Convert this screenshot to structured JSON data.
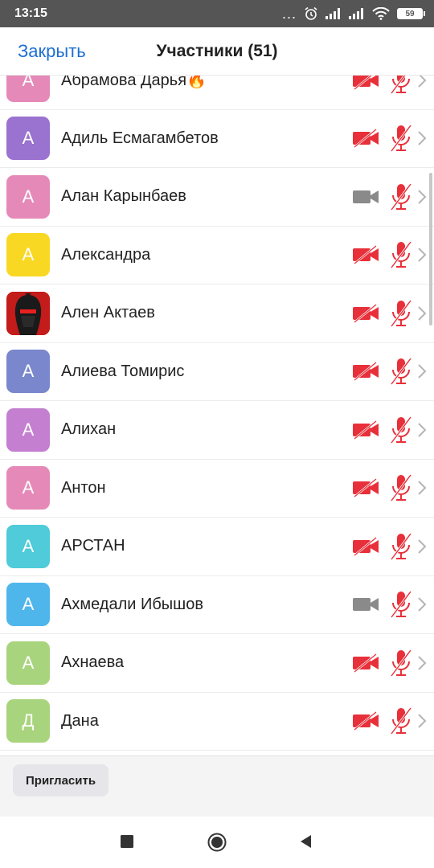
{
  "status_bar": {
    "time": "13:15",
    "signal_dots": "...",
    "battery": "59"
  },
  "header": {
    "close_label": "Закрыть",
    "title": "Участники (51)"
  },
  "participants": [
    {
      "initial": "А",
      "name": "Абрамова Дарья🔥",
      "avatar_color": "#e58ab8",
      "camera": "off",
      "mic": "muted"
    },
    {
      "initial": "А",
      "name": "Адиль Есмагамбетов",
      "avatar_color": "#9a72cf",
      "camera": "off",
      "mic": "muted"
    },
    {
      "initial": "А",
      "name": "Алан Карынбаев",
      "avatar_color": "#e58ab8",
      "camera": "available",
      "mic": "muted"
    },
    {
      "initial": "А",
      "name": "Александра",
      "avatar_color": "#f9d824",
      "camera": "off",
      "mic": "muted"
    },
    {
      "initial": "",
      "name": "Ален Актаев",
      "avatar_color": "#c41b1b",
      "avatar_image": "photo-avatar",
      "camera": "off",
      "mic": "muted"
    },
    {
      "initial": "А",
      "name": "Алиева Томирис",
      "avatar_color": "#7a87cc",
      "camera": "off",
      "mic": "muted"
    },
    {
      "initial": "А",
      "name": "Алихан",
      "avatar_color": "#c47fd1",
      "camera": "off",
      "mic": "muted"
    },
    {
      "initial": "А",
      "name": "Антон",
      "avatar_color": "#e58ab8",
      "camera": "off",
      "mic": "muted"
    },
    {
      "initial": "А",
      "name": "АРСТАН",
      "avatar_color": "#4fcbd9",
      "camera": "off",
      "mic": "muted"
    },
    {
      "initial": "А",
      "name": "Ахмедали Ибышов",
      "avatar_color": "#4fb6ec",
      "camera": "available",
      "mic": "muted"
    },
    {
      "initial": "А",
      "name": "Ахнаева",
      "avatar_color": "#a9d47e",
      "camera": "off",
      "mic": "muted"
    },
    {
      "initial": "Д",
      "name": "Дана",
      "avatar_color": "#a9d47e",
      "camera": "off",
      "mic": "muted"
    }
  ],
  "footer": {
    "invite_label": "Пригласить"
  },
  "colors": {
    "accent": "#1d6fd1",
    "muted_red": "#e8303a",
    "cam_gray": "#8a8a8a"
  },
  "icons": {
    "camera_off": "video-off-icon",
    "camera_on": "video-icon",
    "mic_off": "mic-off-icon",
    "chevron": "chevron-right-icon"
  }
}
